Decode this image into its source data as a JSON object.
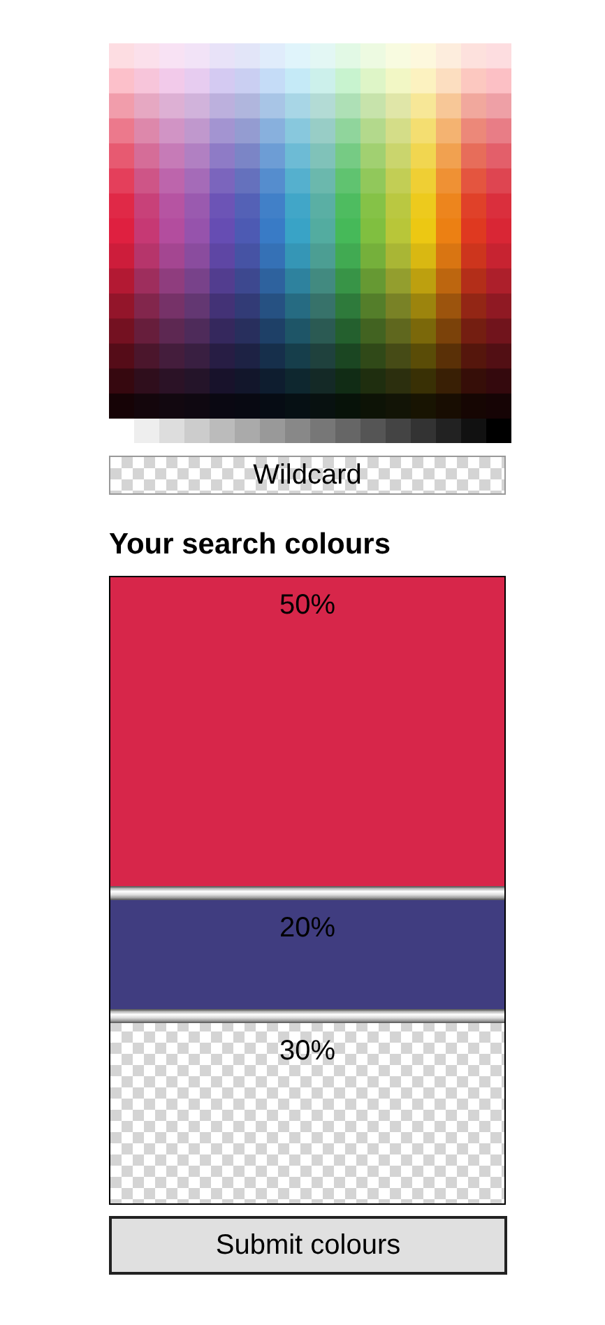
{
  "wildcard": {
    "label": "Wildcard"
  },
  "heading": "Your search colours",
  "segments": [
    {
      "kind": "colour",
      "label": "50%",
      "color": "#d7264a"
    },
    {
      "kind": "colour",
      "label": "20%",
      "color": "#403d80"
    },
    {
      "kind": "wildcard",
      "label": "30%"
    }
  ],
  "submit": {
    "label": "Submit colours"
  }
}
